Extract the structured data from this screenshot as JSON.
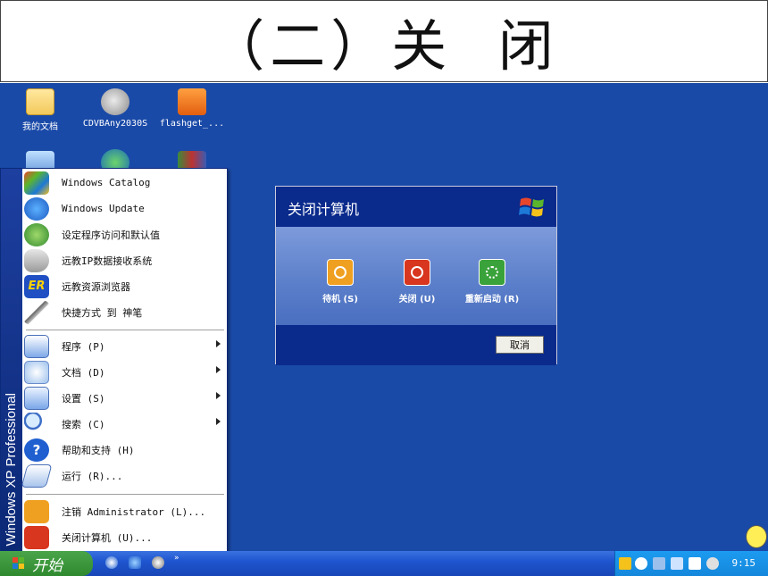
{
  "slide": {
    "title": "（二）关  闭"
  },
  "desktop": {
    "icons": [
      {
        "label": "我的文档",
        "icon": "folder-documents-icon"
      },
      {
        "label": "CDVBAny2030S",
        "icon": "satellite-icon"
      },
      {
        "label": "flashget_...",
        "icon": "flashget-icon"
      }
    ]
  },
  "start_menu": {
    "side_brand": "Windows XP Professional",
    "items": [
      {
        "label": "Windows Catalog",
        "icon": "windows-catalog-icon"
      },
      {
        "label": "Windows Update",
        "icon": "windows-update-icon"
      },
      {
        "label": "设定程序访问和默认值",
        "icon": "program-access-icon"
      },
      {
        "label": "远教IP数据接收系统",
        "icon": "ear-icon"
      },
      {
        "label": "远教资源浏览器",
        "icon": "er-icon"
      },
      {
        "label": "快捷方式 到 神笔",
        "icon": "pen-icon"
      },
      {
        "label": "程序 (P)",
        "icon": "programs-icon",
        "submenu": true
      },
      {
        "label": "文档 (D)",
        "icon": "documents-icon",
        "submenu": true
      },
      {
        "label": "设置 (S)",
        "icon": "settings-icon",
        "submenu": true
      },
      {
        "label": "搜索 (C)",
        "icon": "search-icon",
        "submenu": true
      },
      {
        "label": "帮助和支持 (H)",
        "icon": "help-icon"
      },
      {
        "label": "运行 (R)...",
        "icon": "run-icon"
      },
      {
        "label": "注销 Administrator (L)...",
        "icon": "key-icon"
      },
      {
        "label": "关闭计算机 (U)...",
        "icon": "power-icon"
      }
    ]
  },
  "dialog": {
    "title": "关闭计算机",
    "buttons": [
      {
        "label": "待机 (S)",
        "icon": "standby-icon",
        "color": "#f0a020"
      },
      {
        "label": "关闭 (U)",
        "icon": "shutdown-icon",
        "color": "#d8361e"
      },
      {
        "label": "重新启动 (R)",
        "icon": "restart-icon",
        "color": "#3aa23a"
      }
    ],
    "cancel": "取消"
  },
  "taskbar": {
    "start_label": "开始",
    "clock": "9:15"
  },
  "colors": {
    "desktop": "#1a4aa8",
    "start_green": "#2f8a2f",
    "dialog_header": "#0a2a8c"
  }
}
